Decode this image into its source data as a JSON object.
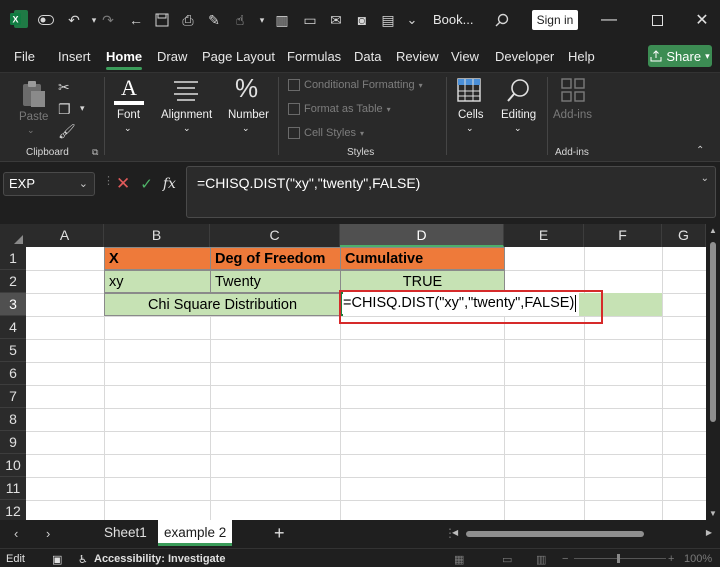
{
  "titlebar": {
    "title": "Book...",
    "signin": "Sign in"
  },
  "menu": {
    "tabs": [
      "File",
      "Insert",
      "Home",
      "Draw",
      "Page Layout",
      "Formulas",
      "Data",
      "Review",
      "View",
      "Developer",
      "Help"
    ],
    "active": "Home",
    "share": "Share"
  },
  "ribbon": {
    "paste": "Paste",
    "clipboard": "Clipboard",
    "font": "Font",
    "alignment": "Alignment",
    "number": "Number",
    "conditional_formatting": "Conditional Formatting",
    "format_as_table": "Format as Table",
    "cell_styles": "Cell Styles",
    "styles": "Styles",
    "cells": "Cells",
    "editing": "Editing",
    "addins": "Add-ins",
    "addins_group": "Add-ins"
  },
  "formula_bar": {
    "name_box": "EXP",
    "fx": "fx",
    "formula": "=CHISQ.DIST(\"xy\",\"twenty\",FALSE)"
  },
  "grid": {
    "columns": [
      "A",
      "B",
      "C",
      "D",
      "E",
      "F",
      "G"
    ],
    "rows": [
      "1",
      "2",
      "3",
      "4",
      "5",
      "6",
      "7",
      "8",
      "9",
      "10",
      "11",
      "12"
    ],
    "b1": "X",
    "c1": "Deg of Freedom",
    "d1": "Cumulative",
    "b2": "xy",
    "c2": "Twenty",
    "d2": "TRUE",
    "b3": "Chi Square Distribution",
    "d3_editing": "=CHISQ.DIST(\"xy\",\"twenty\",FALSE)",
    "colors": {
      "header_fill": "#ee7a3a",
      "data_fill": "#c6e2b4",
      "highlight_box": "#d62a2a"
    }
  },
  "sheets": {
    "tabs": [
      "Sheet1",
      "example 2"
    ],
    "active": "example 2"
  },
  "status": {
    "mode": "Edit",
    "accessibility": "Accessibility: Investigate",
    "zoom": "100%"
  }
}
